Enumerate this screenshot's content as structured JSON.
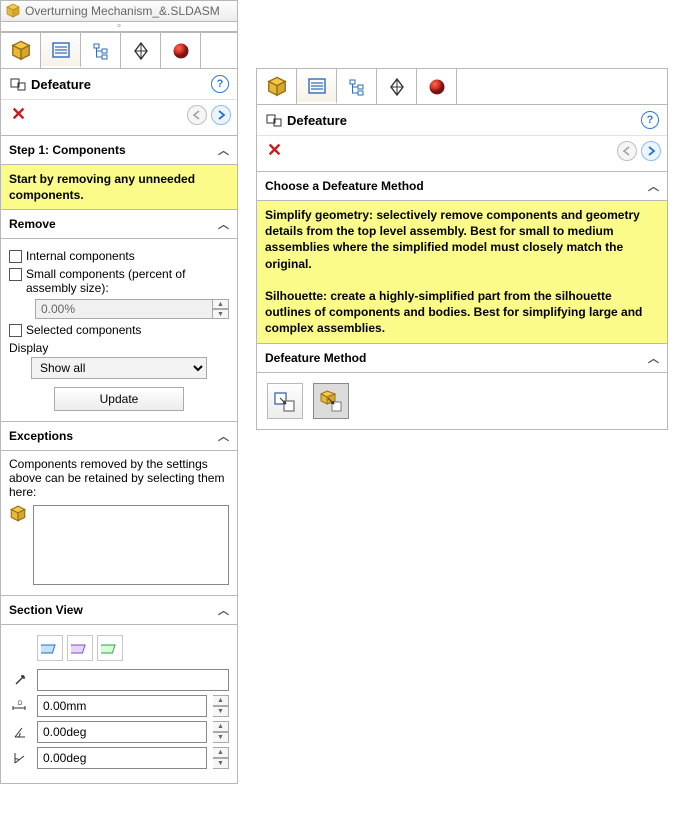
{
  "titlebar": {
    "text": "Overturning Mechanism_&.SLDASM"
  },
  "left": {
    "header": {
      "title": "Defeature"
    },
    "step1": {
      "heading": "Step 1: Components",
      "note": "Start by removing any unneeded components."
    },
    "remove": {
      "heading": "Remove",
      "internal": "Internal components",
      "small": "Small components (percent of assembly size):",
      "percent": "0.00%",
      "selected": "Selected components",
      "display_label": "Display",
      "display_value": "Show all",
      "update": "Update"
    },
    "exceptions": {
      "heading": "Exceptions",
      "text": "Components removed by the settings above can be retained by selecting them here:"
    },
    "section_view": {
      "heading": "Section View",
      "d": "0.00mm",
      "a1": "0.00deg",
      "a2": "0.00deg"
    }
  },
  "right": {
    "header": {
      "title": "Defeature"
    },
    "choose": {
      "heading": "Choose a Defeature Method",
      "note": "Simplify geometry: selectively remove components and geometry details from the top level assembly. Best for small to medium assemblies where the simplified model must closely match the original.\n\nSilhouette: create a highly-simplified part from the silhouette outlines of components and bodies. Best for simplifying large and complex assemblies."
    },
    "method": {
      "heading": "Defeature Method"
    }
  }
}
